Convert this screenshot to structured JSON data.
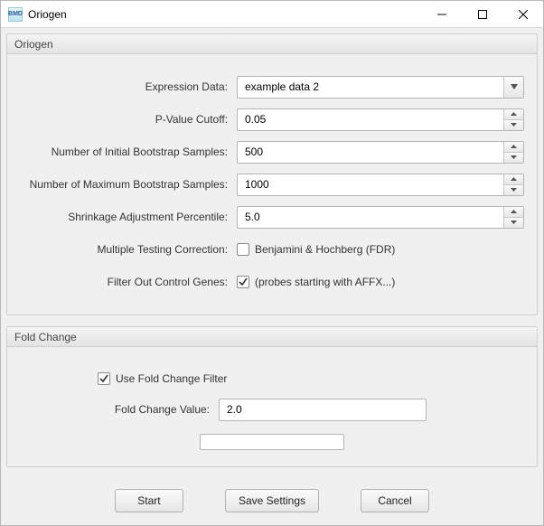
{
  "window": {
    "title": "Oriogen"
  },
  "group1": {
    "title": "Oriogen",
    "expression_data": {
      "label": "Expression Data:",
      "value": "example data 2"
    },
    "pvalue_cutoff": {
      "label": "P-Value Cutoff:",
      "value": "0.05"
    },
    "init_bootstrap": {
      "label": "Number of Initial Bootstrap Samples:",
      "value": "500"
    },
    "max_bootstrap": {
      "label": "Number of Maximum Bootstrap Samples:",
      "value": "1000"
    },
    "shrinkage": {
      "label": "Shrinkage Adjustment Percentile:",
      "value": "5.0"
    },
    "mtc": {
      "label": "Multiple Testing Correction:",
      "text": "Benjamini & Hochberg (FDR)",
      "checked": false
    },
    "filter_ctrl": {
      "label": "Filter Out Control Genes:",
      "text": "(probes starting with AFFX...)",
      "checked": true
    }
  },
  "group2": {
    "title": "Fold Change",
    "use_filter": {
      "text": "Use Fold Change Filter",
      "checked": true
    },
    "fc_value": {
      "label": "Fold Change Value:",
      "value": "2.0"
    }
  },
  "buttons": {
    "start": "Start",
    "save": "Save Settings",
    "cancel": "Cancel"
  }
}
